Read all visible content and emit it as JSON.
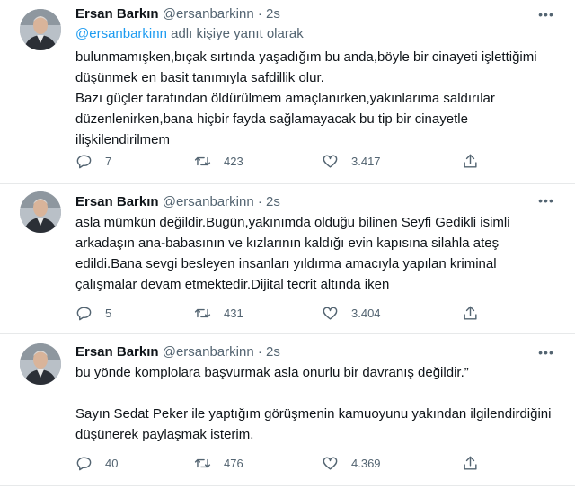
{
  "tweets": [
    {
      "author_name": "Ersan Barkın",
      "handle": "@ersanbarkinn",
      "dot": "·",
      "time": "2s",
      "more_icon": "more-horizontal-icon",
      "reply_mention": "@ersanbarkinn",
      "reply_suffix": " adlı kişiye yanıt olarak",
      "paragraphs": [
        "bulunmamışken,bıçak sırtında yaşadığım bu anda,böyle bir cinayeti işlettiğimi düşünmek en basit tanımıyla safdillik olur.",
        "Bazı güçler tarafından öldürülmem amaçlanırken,yakınlarıma saldırılar düzenlenirken,bana hiçbir fayda sağlamayacak bu tip bir cinayetle ilişkilendirilmem"
      ],
      "reply_count": "7",
      "retweet_count": "423",
      "like_count": "3.417"
    },
    {
      "author_name": "Ersan Barkın",
      "handle": "@ersanbarkinn",
      "dot": "·",
      "time": "2s",
      "more_icon": "more-horizontal-icon",
      "paragraphs": [
        "asla mümkün değildir.Bugün,yakınımda olduğu bilinen Seyfi Gedikli isimli arkadaşın ana-babasının ve kızlarının kaldığı evin kapısına silahla ateş edildi.Bana sevgi besleyen insanları yıldırma amacıyla yapılan kriminal çalışmalar devam etmektedir.Dijital tecrit altında iken"
      ],
      "reply_count": "5",
      "retweet_count": "431",
      "like_count": "3.404"
    },
    {
      "author_name": "Ersan Barkın",
      "handle": "@ersanbarkinn",
      "dot": "·",
      "time": "2s",
      "more_icon": "more-horizontal-icon",
      "paragraphs": [
        "bu yönde komplolara başvurmak asla onurlu bir davranış değildir.”",
        "Sayın Sedat Peker ile yaptığım görüşmenin kamuoyunu yakından ilgilendirdiğini düşünerek paylaşmak isterim."
      ],
      "reply_count": "40",
      "retweet_count": "476",
      "like_count": "4.369"
    }
  ],
  "icons": {
    "reply": "reply-icon",
    "retweet": "retweet-icon",
    "like": "heart-icon",
    "share": "share-icon"
  },
  "colors": {
    "text": "#0f1419",
    "secondary": "#536471",
    "link": "#1d9bf0",
    "divider": "#e7e9ea"
  }
}
